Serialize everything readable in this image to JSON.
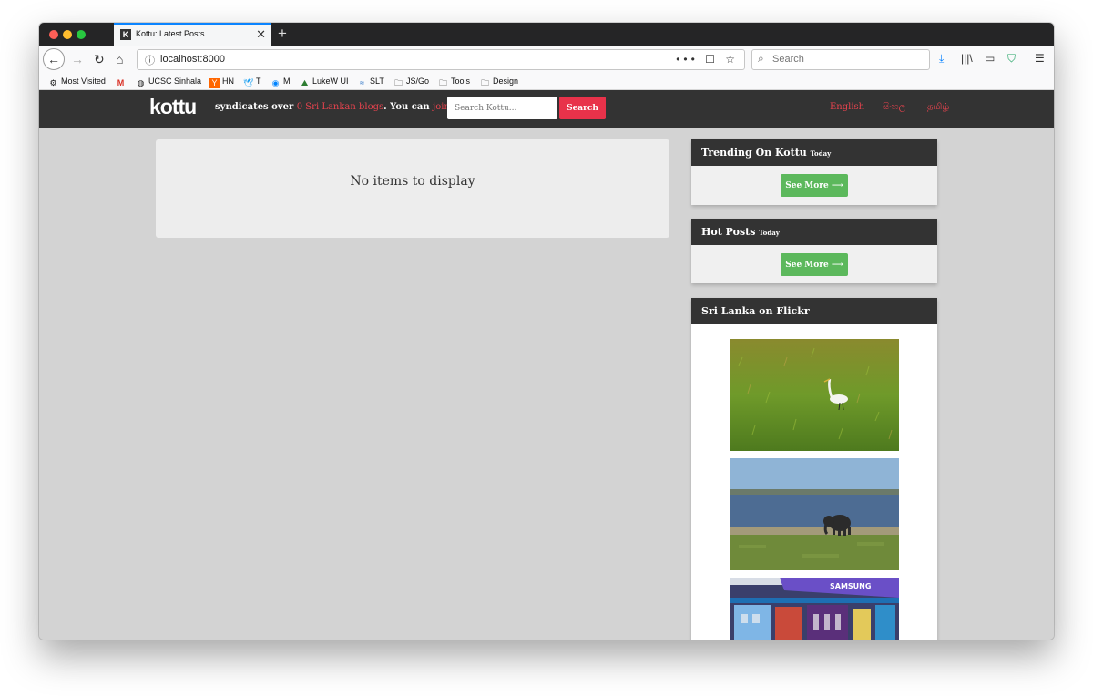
{
  "browser": {
    "tab_title": "Kottu: Latest Posts",
    "tab_favicon": "K",
    "url": "localhost:8000",
    "search_placeholder": "Search"
  },
  "bookmarks": [
    {
      "label": "Most Visited",
      "icon": "gear-icon"
    },
    {
      "label": "",
      "icon": "gmail-icon"
    },
    {
      "label": "UCSC Sinhala",
      "icon": "globe-icon"
    },
    {
      "label": "HN",
      "icon": "hn-icon"
    },
    {
      "label": "T",
      "icon": "twitter-icon"
    },
    {
      "label": "M",
      "icon": "messenger-icon"
    },
    {
      "label": "LukeW UI",
      "icon": "lukew-icon"
    },
    {
      "label": "SLT",
      "icon": "slt-icon"
    },
    {
      "label": "JS/Go",
      "icon": "folder-icon"
    },
    {
      "label": "Tools",
      "icon": "folder-icon"
    },
    {
      "label": "Design",
      "icon": "folder-icon"
    }
  ],
  "site": {
    "logo": "kottu",
    "tagline_prefix": "syndicates over ",
    "tagline_link": "0 Sri Lankan blogs",
    "tagline_middle": ". You can ",
    "tagline_join": "join too",
    "tagline_end": ".",
    "search_placeholder": "Search Kottu...",
    "search_button": "Search",
    "languages": [
      "English",
      "සිංහල",
      "தமிழ்"
    ]
  },
  "main": {
    "empty_message": "No items to display"
  },
  "sidebar": {
    "trending_title": "Trending On Kottu",
    "trending_suffix": "Today",
    "hot_title": "Hot Posts",
    "hot_suffix": "Today",
    "see_more": "See More ⟶",
    "flickr_title": "Sri Lanka on Flickr"
  },
  "colors": {
    "accent": "#e8324a",
    "header": "#333333",
    "see_more": "#5cb85c",
    "page_bg": "#d3d3d3"
  }
}
